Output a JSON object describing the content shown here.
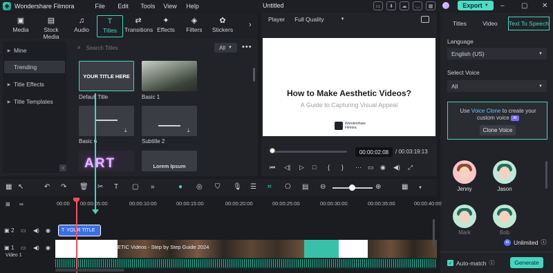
{
  "titlebar": {
    "app_name": "Wondershare Filmora",
    "menu": [
      "File",
      "Edit",
      "Tools",
      "View",
      "Help"
    ],
    "doc_title": "Untitled",
    "export_label": "Export"
  },
  "media_tabs": [
    {
      "label": "Media",
      "icon": "media-icon"
    },
    {
      "label": "Stock Media",
      "icon": "stock-media-icon"
    },
    {
      "label": "Audio",
      "icon": "audio-icon"
    },
    {
      "label": "Titles",
      "icon": "titles-icon",
      "active": true
    },
    {
      "label": "Transitions",
      "icon": "transitions-icon"
    },
    {
      "label": "Effects",
      "icon": "effects-icon"
    },
    {
      "label": "Filters",
      "icon": "filters-icon"
    },
    {
      "label": "Stickers",
      "icon": "stickers-icon"
    }
  ],
  "side_nav": {
    "items": [
      {
        "label": "Mine"
      },
      {
        "label": "Trending",
        "active": true
      },
      {
        "label": "Title Effects"
      },
      {
        "label": "Title Templates"
      }
    ]
  },
  "search": {
    "placeholder": "Search Titles"
  },
  "filter": {
    "label": "All"
  },
  "titles": [
    {
      "label": "Default Title",
      "thumb_text": "YOUR TITLE HERE"
    },
    {
      "label": "Basic 1",
      "thumb_text": ""
    },
    {
      "label": "Basic 6",
      "thumb_text": ""
    },
    {
      "label": "Subtitle 2",
      "thumb_text": ""
    },
    {
      "label": "",
      "thumb_text": "ART"
    },
    {
      "label": "",
      "thumb_text": "Lorem Ipsum"
    }
  ],
  "player": {
    "label": "Player",
    "quality": "Full Quality",
    "preview_title": "How to Make Aesthetic Videos?",
    "preview_subtitle": "A Guide to Capturing Visual Appeal",
    "preview_logo_text": "Wondershare Filmora",
    "current_time": "00:00:02:08",
    "total_time": "/ 00:03:19:13"
  },
  "right_panel": {
    "tabs": [
      {
        "label": "Titles"
      },
      {
        "label": "Video"
      },
      {
        "label": "Text To Speech",
        "active": true
      }
    ],
    "language_label": "Language",
    "language_value": "English (US)",
    "voice_label": "Select Voice",
    "voice_value": "All",
    "clone_text_pre": "Use",
    "clone_link": "Voice Clone",
    "clone_text_post": "to create your custom voice",
    "clone_badge": "AI",
    "clone_button": "Clone Voice",
    "voices": [
      {
        "name": "Jenny"
      },
      {
        "name": "Jason"
      },
      {
        "name": "Mark"
      },
      {
        "name": "Bob"
      }
    ],
    "unlimited_label": "Unlimited",
    "automatch_label": "Auto-match",
    "generate_label": "Generate"
  },
  "timeline": {
    "ruler": [
      "00:00",
      "00:00:05:00",
      "00:00:10:00",
      "00:00:15:00",
      "00:00:20:00",
      "00:00:25:00",
      "00:00:30:00",
      "00:00:35:00",
      "00:00:40:00"
    ],
    "track2_label": "2",
    "track1_label": "1",
    "video_track_name": "Video 1",
    "title_clip_label": "YOUR TITLE",
    "video_clip_text": "ETIC Videos - Step by Step Guide 2024"
  },
  "colors": {
    "accent": "#45d6c2",
    "playhead": "#ff4d5a",
    "title_clip": "#3b6fe8"
  }
}
